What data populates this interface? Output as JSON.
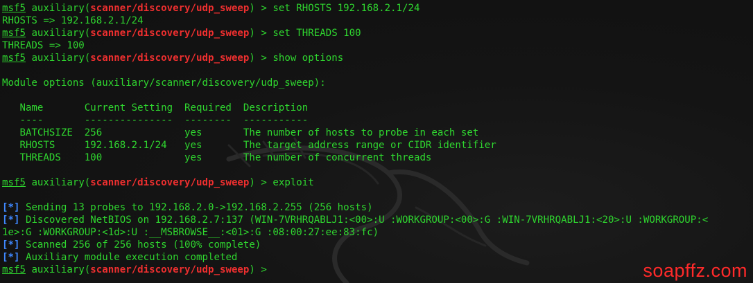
{
  "colors": {
    "text": "#2fd62f",
    "module": "#ef2f2f",
    "status": "#3f88ff",
    "background": "#121212",
    "watermark": "#ff2a2a"
  },
  "icons": {
    "background_logo": "kali-dragon-icon"
  },
  "prompt": {
    "msf": "msf5",
    "prefix": " auxiliary(",
    "module": "scanner/discovery/udp_sweep",
    "suffix": ") > "
  },
  "lines": [
    {
      "type": "prompt",
      "cmd": "set RHOSTS 192.168.2.1/24"
    },
    {
      "type": "out",
      "text": "RHOSTS => 192.168.2.1/24"
    },
    {
      "type": "prompt",
      "cmd": "set THREADS 100"
    },
    {
      "type": "out",
      "text": "THREADS => 100"
    },
    {
      "type": "prompt",
      "cmd": "show options"
    },
    {
      "type": "out",
      "text": ""
    },
    {
      "type": "out",
      "text": "Module options (auxiliary/scanner/discovery/udp_sweep):"
    },
    {
      "type": "out",
      "text": ""
    },
    {
      "type": "out",
      "text": "   Name       Current Setting  Required  Description"
    },
    {
      "type": "out",
      "text": "   ----       ---------------  --------  -----------"
    },
    {
      "type": "out",
      "text": "   BATCHSIZE  256              yes       The number of hosts to probe in each set"
    },
    {
      "type": "out",
      "text": "   RHOSTS     192.168.2.1/24   yes       The target address range or CIDR identifier"
    },
    {
      "type": "out",
      "text": "   THREADS    100              yes       The number of concurrent threads"
    },
    {
      "type": "out",
      "text": ""
    },
    {
      "type": "prompt",
      "cmd": "exploit"
    },
    {
      "type": "out",
      "text": ""
    },
    {
      "type": "status",
      "tag": "[*]",
      "text": " Sending 13 probes to 192.168.2.0->192.168.2.255 (256 hosts)"
    },
    {
      "type": "status",
      "tag": "[*]",
      "text": " Discovered NetBIOS on 192.168.2.7:137 (WIN-7VRHRQABLJ1:<00>:U :WORKGROUP:<00>:G :WIN-7VRHRQABLJ1:<20>:U :WORKGROUP:<"
    },
    {
      "type": "out",
      "text": "1e>:G :WORKGROUP:<1d>:U :__MSBROWSE__:<01>:G :08:00:27:ee:83:fc)"
    },
    {
      "type": "status",
      "tag": "[*]",
      "text": " Scanned 256 of 256 hosts (100% complete)"
    },
    {
      "type": "status",
      "tag": "[*]",
      "text": " Auxiliary module execution completed"
    },
    {
      "type": "prompt",
      "cmd": ""
    }
  ],
  "watermark": "soapffz.com"
}
